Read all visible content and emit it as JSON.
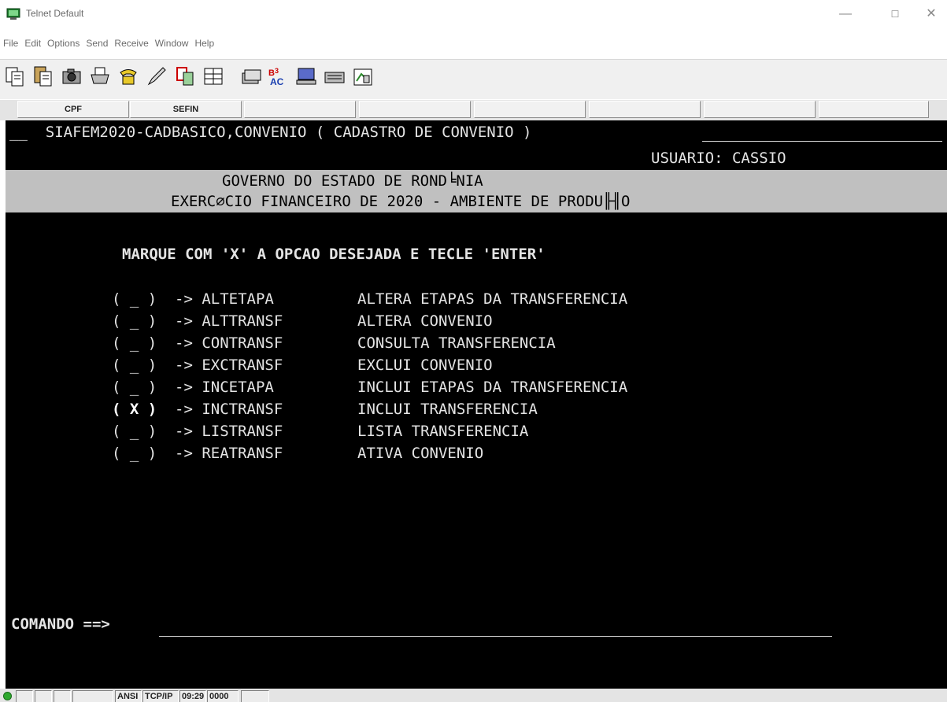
{
  "window": {
    "title": "Telnet Default",
    "minimize": "—",
    "maximize": "☐",
    "close": "✕"
  },
  "menu": [
    "File",
    "Edit",
    "Options",
    "Send",
    "Receive",
    "Window",
    "Help"
  ],
  "toolbar_icons": [
    "copy-icon",
    "paste-icon",
    "camera-icon",
    "print-icon",
    "phone-icon",
    "pen-icon",
    "transfer-icon",
    "keyboard-map-icon",
    "stack-icon",
    "spellcheck-icon",
    "terminal-icon",
    "keyboard-icon",
    "settings-icon"
  ],
  "fkeys": [
    "CPF",
    "SEFIN",
    "",
    "",
    "",
    "",
    "",
    "",
    ""
  ],
  "terminal": {
    "header": "__  SIAFEM2020-CADBASICO,CONVENIO ( CADASTRO DE CONVENIO )",
    "user": "USUARIO: CASSIO",
    "band_line1": "GOVERNO DO ESTADO DE ROND╘NIA",
    "band_line2": "EXERC⌀CIO FINANCEIRO DE 2020 - AMBIENTE DE PRODU╟╢O",
    "instruction": "MARQUE COM 'X' A OPCAO DESEJADA E TECLE 'ENTER'",
    "options": [
      {
        "mark": "( _ )",
        "code": "-> ALTETAPA",
        "desc": "ALTERA ETAPAS DA TRANSFERENCIA"
      },
      {
        "mark": "( _ )",
        "code": "-> ALTTRANSF",
        "desc": "ALTERA CONVENIO"
      },
      {
        "mark": "( _ )",
        "code": "-> CONTRANSF",
        "desc": "CONSULTA TRANSFERENCIA"
      },
      {
        "mark": "( _ )",
        "code": "-> EXCTRANSF",
        "desc": "EXCLUI CONVENIO"
      },
      {
        "mark": "( _ )",
        "code": "-> INCETAPA",
        "desc": "INCLUI ETAPAS DA TRANSFERENCIA"
      },
      {
        "mark": "( X )",
        "code": "-> INCTRANSF",
        "desc": "INCLUI TRANSFERENCIA"
      },
      {
        "mark": "( _ )",
        "code": "-> LISTRANSF",
        "desc": "LISTA TRANSFERENCIA"
      },
      {
        "mark": "( _ )",
        "code": "-> REATRANSF",
        "desc": "ATIVA CONVENIO"
      }
    ],
    "command_label": "COMANDO ==>",
    "command_value": ""
  },
  "status": {
    "mode": "ANSI",
    "protocol": "TCP/IP",
    "time": "09:29",
    "counter": "0000"
  },
  "colors": {
    "terminal_bg": "#000000",
    "terminal_fg": "#e4e4e4",
    "band_bg": "#c0c0c0",
    "led": "#2ea82e"
  }
}
